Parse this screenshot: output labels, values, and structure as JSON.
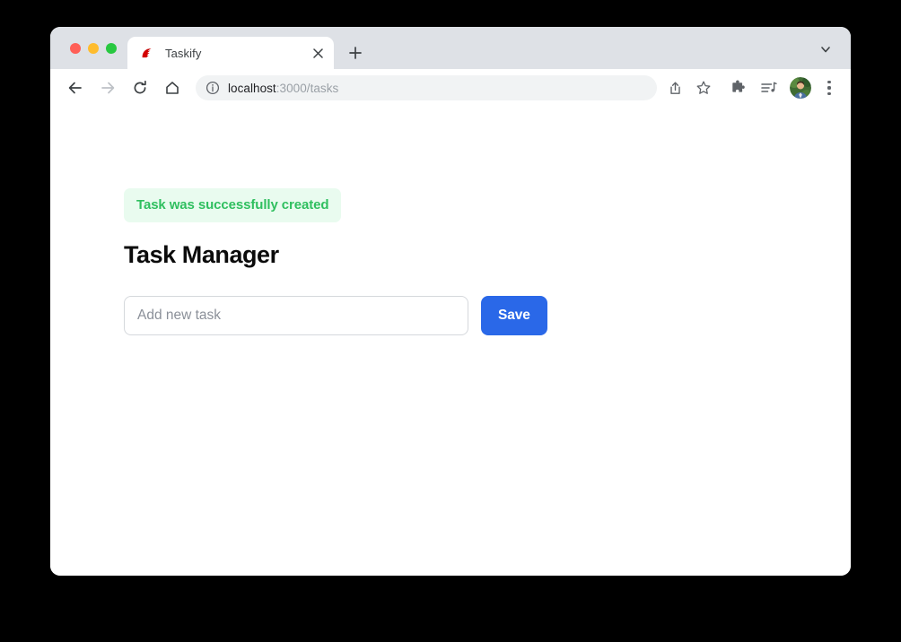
{
  "browser": {
    "traffic_lights": [
      {
        "name": "close",
        "color": "#ff5f57"
      },
      {
        "name": "minimize",
        "color": "#febc2e"
      },
      {
        "name": "maximize",
        "color": "#28c840"
      }
    ],
    "tab": {
      "title": "Taskify",
      "favicon": "rails-logo-icon",
      "close_icon": "close-icon"
    },
    "new_tab_icon": "plus-icon",
    "tab_search_icon": "chevron-down-icon",
    "nav": {
      "back_icon": "back-arrow-icon",
      "forward_icon": "forward-arrow-icon",
      "reload_icon": "reload-icon",
      "home_icon": "home-icon"
    },
    "omnibox": {
      "info_icon": "info-circle-icon",
      "url_host": "localhost",
      "url_path": ":3000/tasks",
      "share_icon": "share-icon",
      "bookmark_icon": "star-icon"
    },
    "toolbar_icons": {
      "extensions": "puzzle-piece-icon",
      "reading_list": "media-list-icon",
      "profile": "avatar-icon",
      "menu": "three-dot-menu-icon"
    }
  },
  "page": {
    "flash_message": "Task was successfully created",
    "flash_bg_color": "#e9fbef",
    "flash_text_color": "#2fbf5f",
    "title": "Task Manager",
    "form": {
      "input_placeholder": "Add new task",
      "input_value": "",
      "save_label": "Save",
      "save_color": "#2a68e8"
    }
  }
}
